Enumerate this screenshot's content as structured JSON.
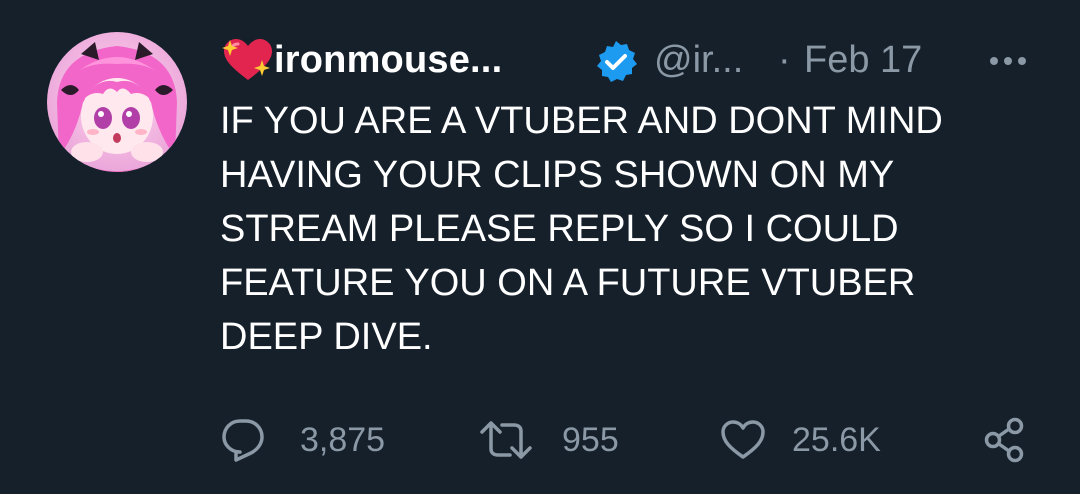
{
  "tweet": {
    "display_name": "ironmouse...",
    "handle": "@ir...",
    "separator": "·",
    "date": "Feb 17",
    "text": "IF YOU ARE A VTUBER AND DONT MIND\nHAVING YOUR CLIPS SHOWN ON MY\nSTREAM PLEASE REPLY SO I COULD\nFEATURE YOU ON A FUTURE VTUBER\nDEEP DIVE.",
    "stats": {
      "replies": "3,875",
      "retweets": "955",
      "likes": "25.6K"
    }
  },
  "icons": {
    "name_emoji": "sparkling-heart-icon",
    "verified": "verified-badge-icon",
    "more": "more-options-icon",
    "reply": "reply-icon",
    "retweet": "retweet-icon",
    "like": "heart-icon",
    "share": "share-icon"
  },
  "colors": {
    "background": "#15202b",
    "text": "#ffffff",
    "secondary_text": "#8b98a5",
    "verified": "#1d9bf0",
    "heart_emoji": "#e2254f"
  }
}
